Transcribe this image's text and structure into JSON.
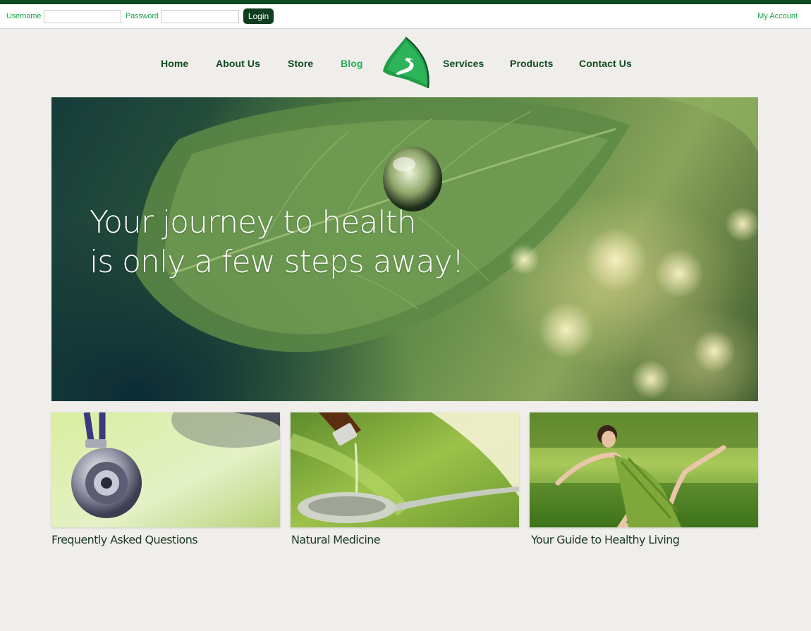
{
  "login": {
    "username_label": "Username",
    "username_value": "",
    "password_label": "Password",
    "password_value": "",
    "login_button": "Login",
    "my_account": "My Account"
  },
  "nav": {
    "items": [
      {
        "label": "Home"
      },
      {
        "label": "About Us"
      },
      {
        "label": "Store"
      },
      {
        "label": "Blog",
        "active": true
      },
      {
        "label": "Services"
      },
      {
        "label": "Products"
      },
      {
        "label": "Contact Us"
      }
    ],
    "logo_icon": "leaf-path-logo-icon"
  },
  "hero": {
    "line1": "Your journey to health",
    "line2": "is only a few steps away!"
  },
  "cards": [
    {
      "title": "Frequently Asked Questions",
      "image": "stethoscope-image"
    },
    {
      "title": "Natural Medicine",
      "image": "medicine-spoon-image"
    },
    {
      "title": "Your Guide to Healthy Living",
      "image": "woman-in-field-image"
    }
  ],
  "colors": {
    "brand_dark": "#0e4a22",
    "brand_accent": "#23b058",
    "background": "#f0eeea"
  }
}
